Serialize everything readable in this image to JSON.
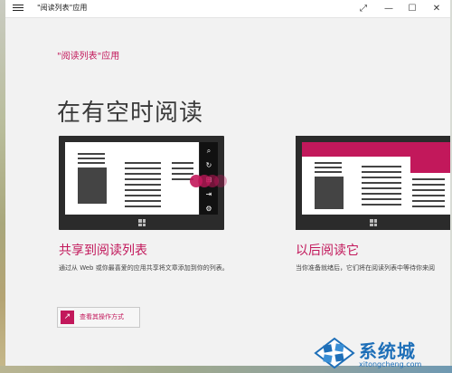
{
  "window": {
    "title": "\"阅读列表\"应用",
    "controls": [
      "⤢",
      "—",
      "☐",
      "✕"
    ]
  },
  "page": {
    "app_title": "\"阅读列表\"应用",
    "heading": "在有空时阅读"
  },
  "cards": [
    {
      "title": "共享到阅读列表",
      "description": "通过从 Web 或你最喜爱的应用共享将文章添加到你的列表。"
    },
    {
      "title": "以后阅读它",
      "description": "当你准备就绪后，它们将在阅读列表中等待你来阅"
    }
  ],
  "action": {
    "label": "查看其操作方式",
    "icon": "arrow-out-icon"
  },
  "charm_icons": [
    "search-icon",
    "share-icon",
    "start-icon",
    "devices-icon",
    "settings-icon"
  ],
  "watermark": {
    "main": "系统城",
    "sub": "xitongcheng.com"
  },
  "colors": {
    "accent": "#c2185b",
    "watermark": "#1e6fb8"
  }
}
